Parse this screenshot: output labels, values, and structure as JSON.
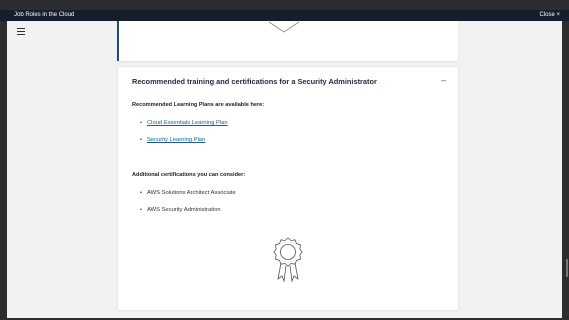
{
  "window": {
    "title": "Job Roles in the Cloud",
    "close_label": "Close ×"
  },
  "section": {
    "heading": "Recommended training and certifications for a Security Administrator",
    "collapse_symbol": "–",
    "learning_plans_heading": "Recommended Learning Plans are available here:",
    "learning_plans": [
      {
        "label": "Cloud Essentials Learning Plan"
      },
      {
        "label": "Security Learning Plan"
      }
    ],
    "certifications_heading": "Additional certifications you can consider:",
    "certifications": [
      {
        "label": "AWS Solutions Architect Associate"
      },
      {
        "label": "AWS Security Administration"
      }
    ]
  },
  "colors": {
    "titlebar": "#161e2d",
    "link": "#1a5f9c",
    "accent_border": "#1f4e79"
  },
  "icons": {
    "menu": "hamburger-menu-icon",
    "award": "award-ribbon-icon",
    "chevron": "chevron-down-icon"
  }
}
